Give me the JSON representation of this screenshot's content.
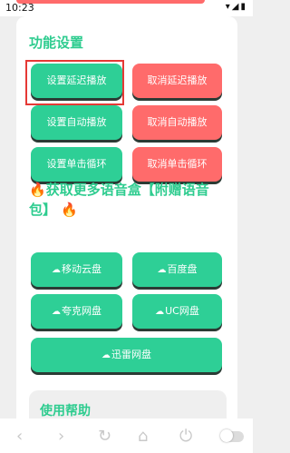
{
  "status_bar": {
    "time": "10:23",
    "icons": [
      "wifi-icon",
      "signal-icon",
      "battery-icon"
    ]
  },
  "section": {
    "title": "功能设置"
  },
  "buttons": {
    "set_delay": "设置延迟播放",
    "cancel_delay": "取消延迟播放",
    "set_auto": "设置自动播放",
    "cancel_auto": "取消自动播放",
    "set_loop": "设置单击循环",
    "cancel_loop": "取消单击循环"
  },
  "promo": {
    "line1": "获取更多语音盒【附赠语音",
    "line2": "包】"
  },
  "cloud_buttons": {
    "mobile_cloud": "移动云盘",
    "baidu": "百度盘",
    "quark": "夸克网盘",
    "uc": "UC网盘",
    "xunlei": "迅雷网盘"
  },
  "help": {
    "title": "使用帮助"
  },
  "colors": {
    "accent_green": "#2ecf96",
    "title_green": "#2ecc8f",
    "red": "#ff6b6b"
  }
}
